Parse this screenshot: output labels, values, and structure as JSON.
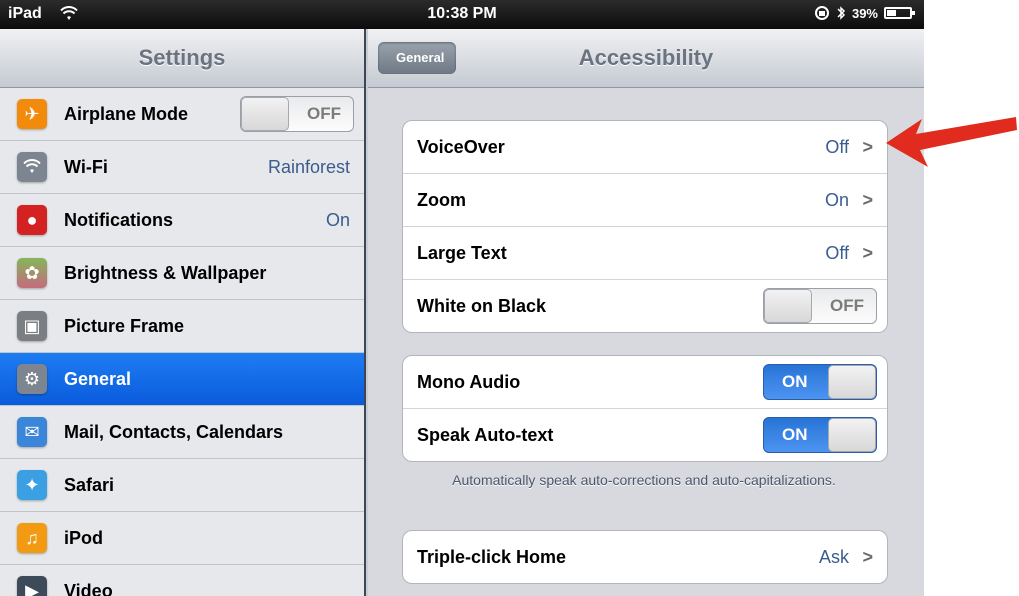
{
  "status": {
    "carrier": "iPad",
    "time": "10:38 PM",
    "battery": "39%",
    "battery_level": 0.39
  },
  "sidebar": {
    "title": "Settings",
    "items": [
      {
        "label": "Airplane Mode",
        "toggle": "OFF",
        "icon": "airplane-icon",
        "color": "#f28a0b"
      },
      {
        "label": "Wi-Fi",
        "value": "Rainforest",
        "icon": "wifi-icon",
        "color": "#7d8590"
      },
      {
        "label": "Notifications",
        "value": "On",
        "icon": "notifications-icon",
        "color": "#d42121"
      },
      {
        "label": "Brightness & Wallpaper",
        "icon": "flower-icon",
        "color": "#c46b7e"
      },
      {
        "label": "Picture Frame",
        "icon": "picture-frame-icon",
        "color": "#7b7e82"
      },
      {
        "label": "General",
        "icon": "gear-icon",
        "color": "#7d8590",
        "selected": true
      },
      {
        "label": "Mail, Contacts, Calendars",
        "icon": "mail-icon",
        "color": "#3b86d8"
      },
      {
        "label": "Safari",
        "icon": "compass-icon",
        "color": "#3aa0e3"
      },
      {
        "label": "iPod",
        "icon": "ipod-icon",
        "color": "#f39a13"
      },
      {
        "label": "Video",
        "icon": "video-icon",
        "color": "#3d4a5a"
      }
    ]
  },
  "detail": {
    "back": "General",
    "title": "Accessibility",
    "group1": [
      {
        "label": "VoiceOver",
        "value": "Off"
      },
      {
        "label": "Zoom",
        "value": "On"
      },
      {
        "label": "Large Text",
        "value": "Off"
      },
      {
        "label": "White on Black",
        "toggle": "OFF"
      }
    ],
    "group2": [
      {
        "label": "Mono Audio",
        "toggle": "ON"
      },
      {
        "label": "Speak Auto-text",
        "toggle": "ON"
      }
    ],
    "footnote": "Automatically speak auto-corrections and auto-capitalizations.",
    "group3": [
      {
        "label": "Triple-click Home",
        "value": "Ask"
      }
    ]
  },
  "chevron": ">",
  "accent_color": "#0a5bdc",
  "annotation_color": "#e02b1e"
}
